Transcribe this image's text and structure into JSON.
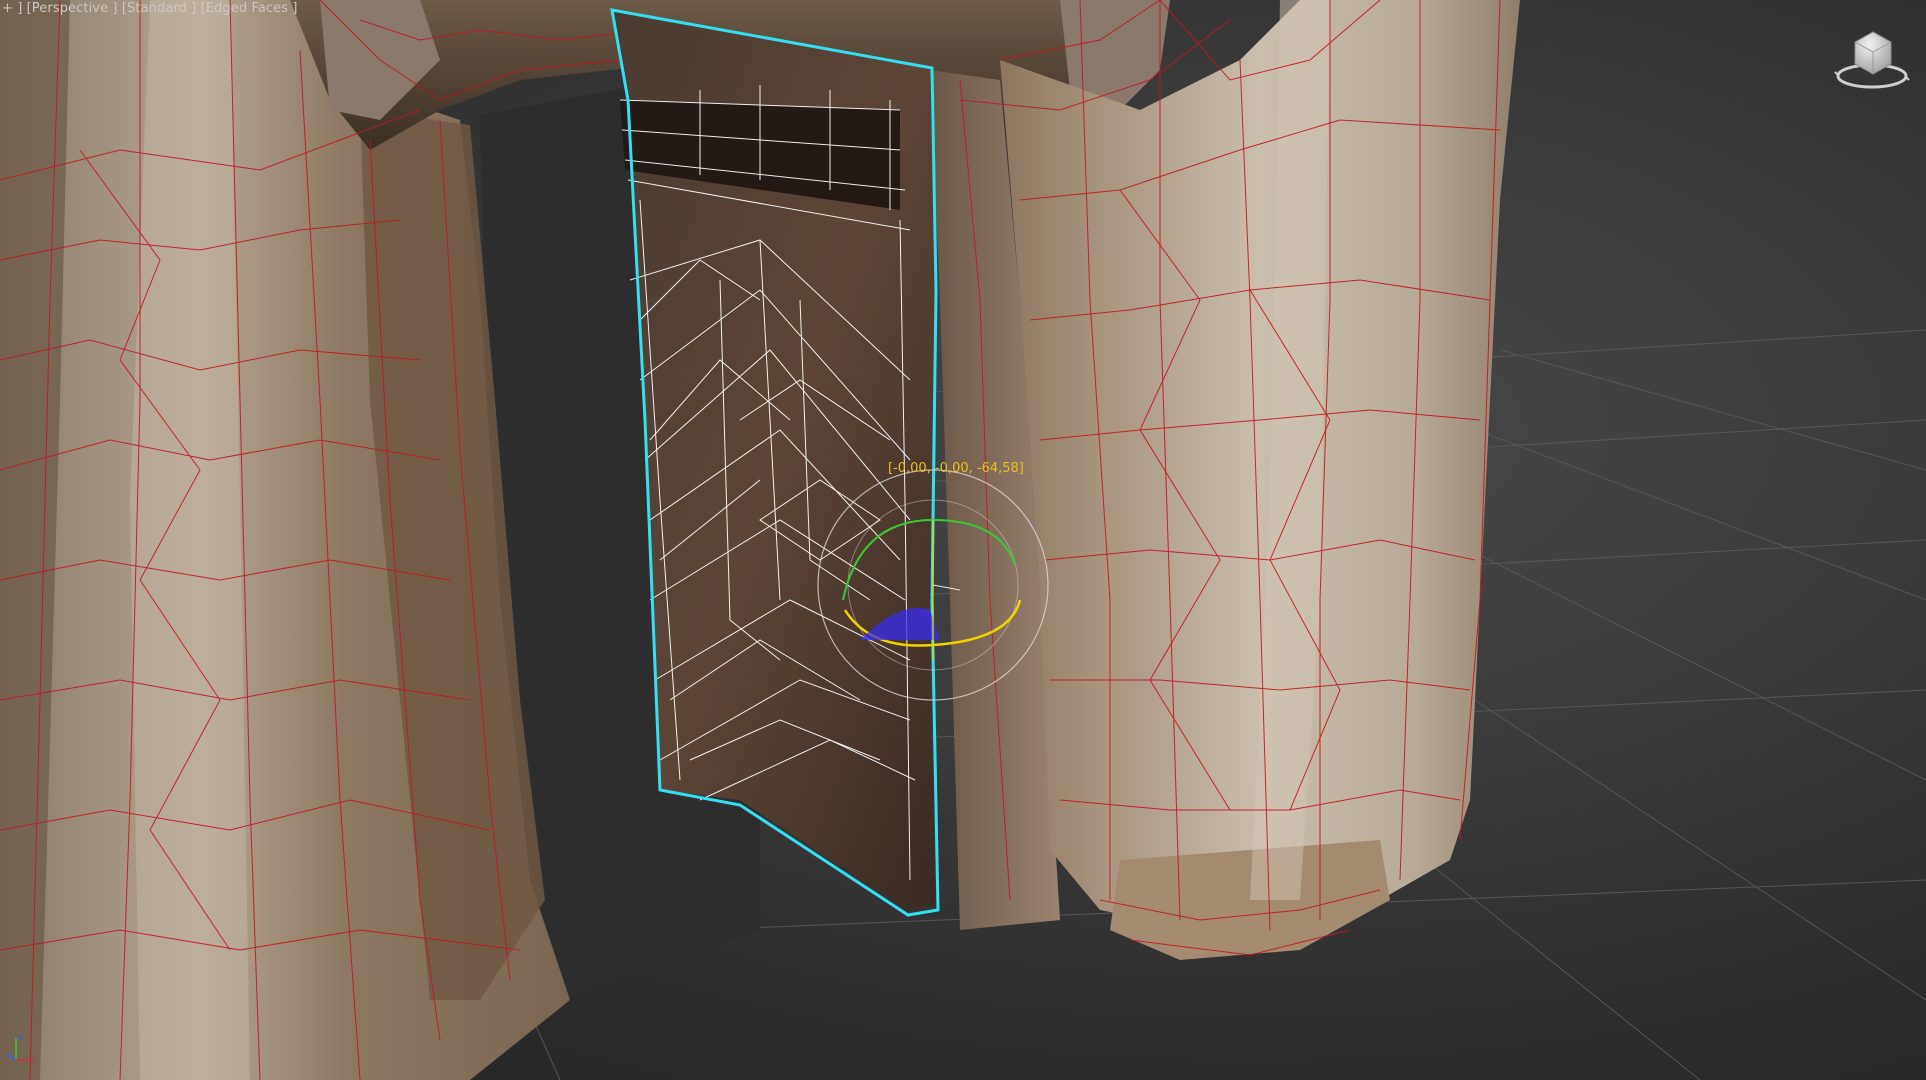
{
  "viewport": {
    "label_plus": "+ ]",
    "label_view": "[Perspective ]",
    "label_shading": "[Standard ]",
    "label_mode": "[Edged Faces ]"
  },
  "transform_readout": "[-0,00, -0,00, -64,58]",
  "colors": {
    "selection_outline": "#35dff0",
    "wireframe_selected": "#ffffff",
    "wireframe_unselected": "#c0181c",
    "gizmo_yellow": "#f0d400",
    "gizmo_green": "#3cc832",
    "gizmo_blue": "#3a2cf0",
    "readout_text": "#e8c020",
    "grid": "#5a5a5a"
  },
  "icons": {
    "viewcube": "viewcube-icon",
    "axis_tripod": "axis-tripod-icon",
    "rotate_gizmo": "rotate-gizmo-icon"
  }
}
